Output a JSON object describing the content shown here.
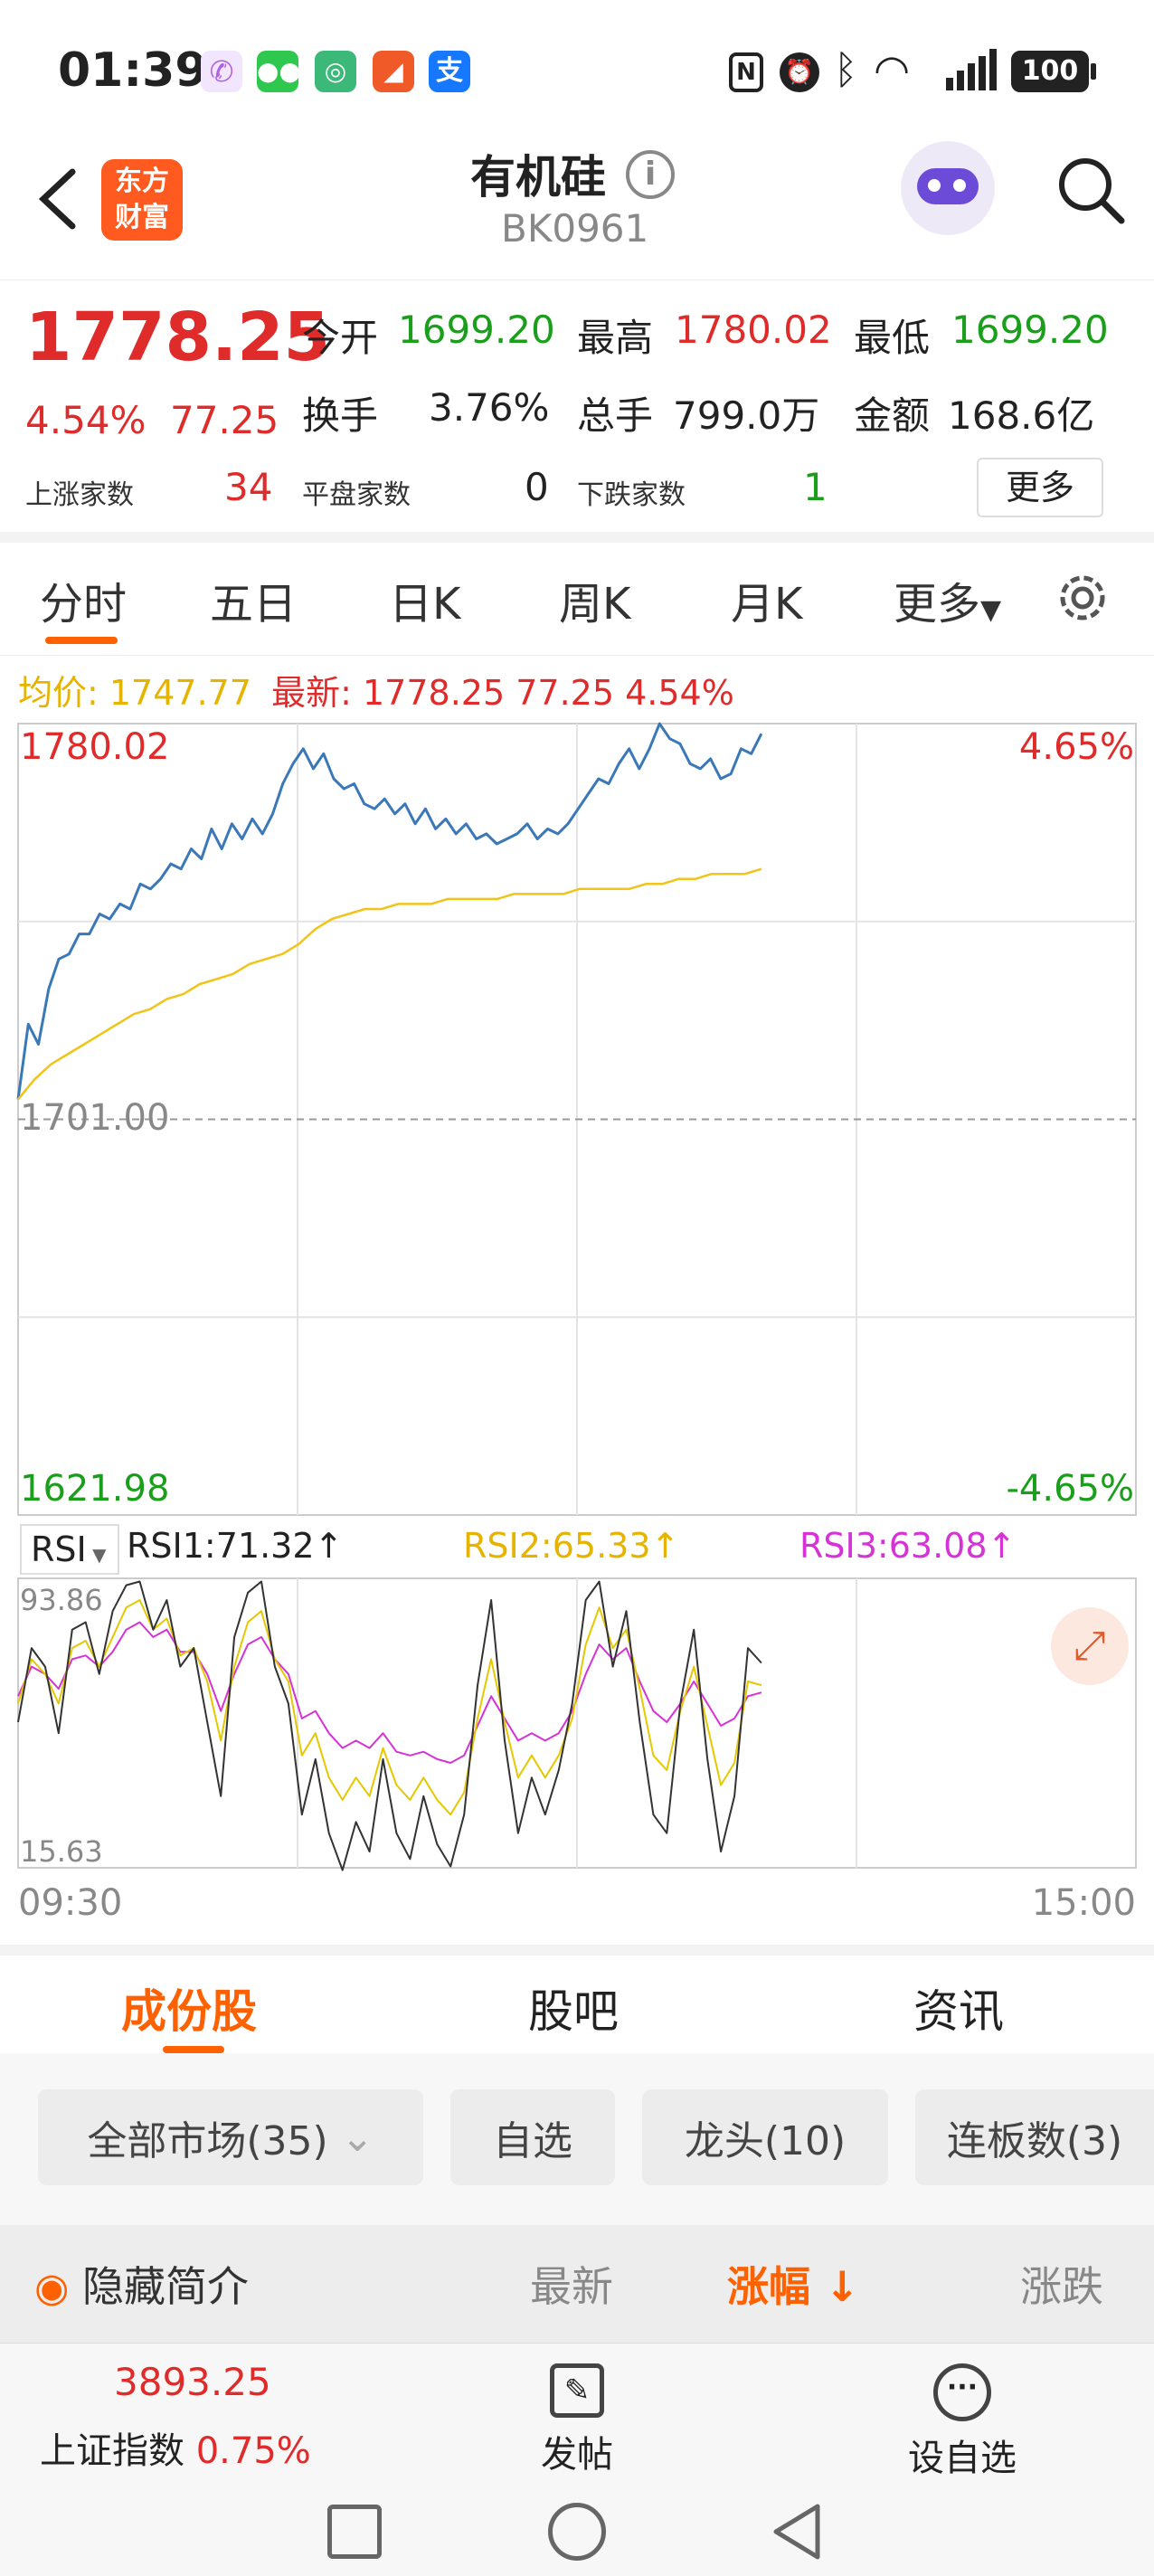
{
  "status_bar": {
    "time": "01:39",
    "battery": "100"
  },
  "nav": {
    "back_label": "<",
    "logo_line1": "东方",
    "logo_line2": "财富",
    "title": "有机硅",
    "code": "BK0961"
  },
  "quote": {
    "price": "1778.25",
    "change_pct": "4.54%",
    "change": "77.25",
    "open_label": "今开",
    "open_value": "1699.20",
    "high_label": "最高",
    "high_value": "1780.02",
    "low_label": "最低",
    "low_value": "1699.20",
    "turnover_label": "换手",
    "turnover_value": "3.76%",
    "volume_label": "总手",
    "volume_value": "799.0万",
    "amount_label": "金额",
    "amount_value": "168.6亿",
    "up_label": "上涨家数",
    "up_value": "34",
    "flat_label": "平盘家数",
    "flat_value": "0",
    "down_label": "下跌家数",
    "down_value": "1",
    "more_label": "更多"
  },
  "tabs": {
    "intraday": "分时",
    "five_day": "五日",
    "day_k": "日K",
    "week_k": "周K",
    "month_k": "月K",
    "more": "更多"
  },
  "chart_header": {
    "avg_label": "均价: 1747.77",
    "latest_label": "最新: 1778.25 77.25 4.54%"
  },
  "chart_data": [
    {
      "type": "line",
      "x_range": [
        "09:30",
        "15:00"
      ],
      "ylim": [
        1621.98,
        1780.02
      ],
      "baseline": 1701.0,
      "right_labels": {
        "top": "4.65%",
        "bottom": "-4.65%"
      },
      "left_labels": {
        "top": "1780.02",
        "mid": "1701.00",
        "bottom": "1621.98"
      },
      "series": [
        {
          "values": [
            1705,
            1720,
            1716,
            1727,
            1733,
            1734,
            1738,
            1738,
            1742,
            1741,
            1744,
            1743,
            1748,
            1747,
            1749,
            1752,
            1751,
            1755,
            1753,
            1759,
            1755,
            1760,
            1757,
            1761,
            1758,
            1762,
            1768,
            1772,
            1775,
            1771,
            1774,
            1769,
            1767,
            1768,
            1764,
            1763,
            1765,
            1762,
            1764,
            1760,
            1763,
            1759,
            1761,
            1758,
            1760,
            1757,
            1758,
            1756,
            1757,
            1758,
            1760,
            1757,
            1759,
            1758,
            1760,
            1763,
            1766,
            1769,
            1768,
            1772,
            1775,
            1771,
            1775,
            1780,
            1777,
            1776,
            1772,
            1771,
            1773,
            1769,
            1770,
            1775,
            1774,
            1778
          ]
        },
        {
          "values": [
            1705,
            1709,
            1712,
            1714,
            1716,
            1718,
            1720,
            1722,
            1723,
            1725,
            1726,
            1728,
            1729,
            1730,
            1732,
            1733,
            1734,
            1736,
            1739,
            1741,
            1742,
            1743,
            1743,
            1744,
            1744,
            1744,
            1745,
            1745,
            1745,
            1745,
            1746,
            1746,
            1746,
            1746,
            1747,
            1747,
            1747,
            1747,
            1748,
            1748,
            1749,
            1749,
            1750,
            1750,
            1750,
            1751
          ]
        }
      ]
    },
    {
      "type": "line",
      "ylim": [
        15.63,
        93.86
      ],
      "left_labels": {
        "top": "93.86",
        "bottom": "15.63"
      },
      "series": [
        {
          "name": "RSI1:71.32↑",
          "values": [
            55,
            75,
            70,
            52,
            80,
            82,
            68,
            85,
            92,
            93,
            80,
            88,
            70,
            75,
            55,
            35,
            78,
            90,
            93,
            70,
            60,
            30,
            45,
            25,
            15,
            28,
            20,
            45,
            25,
            18,
            35,
            22,
            16,
            30,
            65,
            88,
            50,
            25,
            40,
            30,
            42,
            60,
            88,
            93,
            70,
            85,
            55,
            30,
            25,
            60,
            80,
            45,
            20,
            35,
            75,
            71
          ]
        },
        {
          "name": "RSI2:65.33↑",
          "values": [
            60,
            72,
            68,
            60,
            75,
            77,
            70,
            78,
            86,
            88,
            80,
            83,
            73,
            75,
            66,
            50,
            70,
            82,
            85,
            72,
            66,
            46,
            52,
            40,
            34,
            40,
            35,
            48,
            38,
            34,
            40,
            34,
            30,
            36,
            56,
            72,
            55,
            40,
            46,
            40,
            46,
            56,
            76,
            86,
            75,
            80,
            64,
            46,
            42,
            58,
            70,
            54,
            38,
            44,
            66,
            65
          ]
        },
        {
          "name": "RSI3:63.08↑",
          "values": [
            62,
            70,
            68,
            64,
            72,
            73,
            70,
            74,
            80,
            82,
            78,
            80,
            74,
            74,
            68,
            58,
            68,
            76,
            78,
            72,
            68,
            56,
            58,
            52,
            48,
            50,
            48,
            52,
            47,
            46,
            47,
            45,
            44,
            46,
            54,
            62,
            56,
            50,
            52,
            50,
            52,
            58,
            68,
            76,
            72,
            75,
            66,
            58,
            55,
            60,
            66,
            60,
            54,
            56,
            62,
            63
          ]
        }
      ],
      "colors": [
        "#333333",
        "#e6c800",
        "#d633d6"
      ],
      "x_range": [
        "09:30",
        "15:00"
      ]
    }
  ],
  "rsi_selector": "RSI",
  "sub_tabs": {
    "components": "成份股",
    "forum": "股吧",
    "news": "资讯"
  },
  "filters": {
    "all_markets": "全部市场(35)",
    "watchlist": "自选",
    "leaders": "龙头(10)",
    "limit_up": "连板数(3)"
  },
  "list_header": {
    "hide_intro": "隐藏简介",
    "latest": "最新",
    "change_pct": "涨幅",
    "change": "涨跌"
  },
  "bottom_bar": {
    "index_value": "3893.25",
    "index_name": "上证指数",
    "index_pct": "0.75%",
    "post_label": "发帖",
    "watch_label": "设自选"
  },
  "colors": {
    "up": "#e02b2b",
    "down": "#1b9e1b",
    "accent": "#ff6000",
    "price_line": "#3a78b8",
    "avg_line": "#f0c419"
  }
}
